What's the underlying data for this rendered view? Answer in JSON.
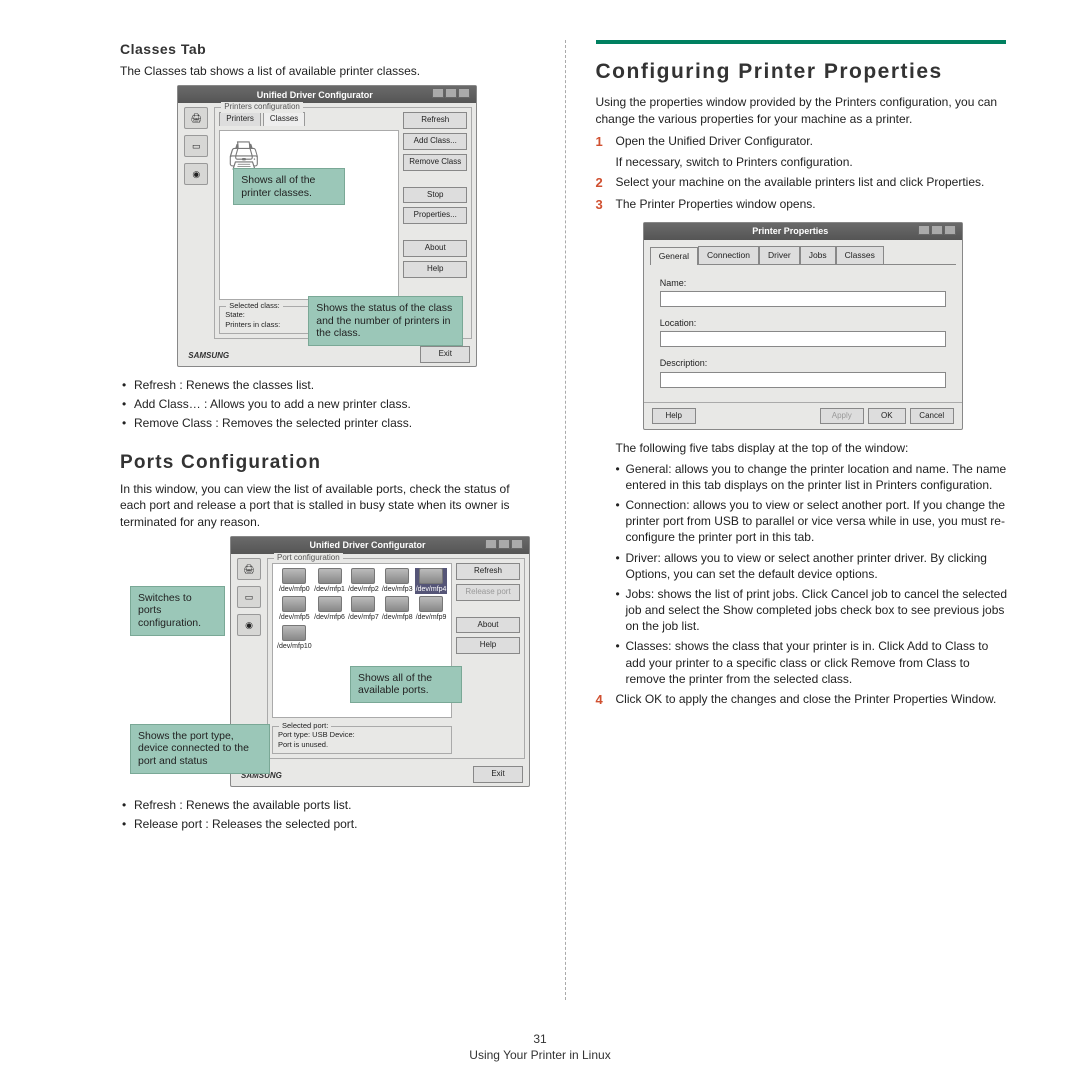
{
  "left": {
    "classes_heading": "Classes Tab",
    "classes_intro": "The Classes tab shows a list of available printer classes.",
    "classes_win_title": "Unified Driver Configurator",
    "classes_frame": "Printers configuration",
    "classes_tab_printers": "Printers",
    "classes_tab_classes": "Classes",
    "classes_buttons": {
      "refresh": "Refresh",
      "add": "Add Class...",
      "remove": "Remove Class",
      "stop": "Stop",
      "properties": "Properties...",
      "about": "About",
      "help": "Help"
    },
    "classes_sel_label": "Selected class:",
    "classes_sel_state": "State:",
    "classes_sel_printers": "Printers in class:",
    "classes_exit": "Exit",
    "classes_brand": "SAMSUNG",
    "callout_classes_1": "Shows all of the printer classes.",
    "callout_classes_2": "Shows the status of the class and the number of printers in the class.",
    "classes_bullets": [
      "Refresh : Renews the classes list.",
      "Add Class… : Allows you to add a new printer class.",
      "Remove Class : Removes the selected printer class."
    ],
    "ports_heading": "Ports Configuration",
    "ports_intro": "In this window, you can view the list of available ports, check the status of each port and release a port that is stalled in busy state when its owner is terminated for any reason.",
    "ports_win_title": "Unified Driver Configurator",
    "ports_frame": "Port configuration",
    "port_labels": [
      "/dev/mfp0",
      "/dev/mfp1",
      "/dev/mfp2",
      "/dev/mfp3",
      "/dev/mfp4",
      "/dev/mfp5",
      "/dev/mfp6",
      "/dev/mfp7",
      "/dev/mfp8",
      "/dev/mfp9",
      "/dev/mfp10"
    ],
    "ports_buttons": {
      "refresh": "Refresh",
      "release": "Release port",
      "about": "About",
      "help": "Help"
    },
    "ports_sel_label": "Selected port:",
    "ports_sel_type": "Port type: USB   Device:",
    "ports_sel_status": "Port is unused.",
    "ports_exit": "Exit",
    "callout_ports_1": "Switches to ports configuration.",
    "callout_ports_2": "Shows all of the available ports.",
    "callout_ports_3": "Shows the port type, device connected to the port and status",
    "ports_bullets": [
      "Refresh : Renews the available ports list.",
      "Release port : Releases the selected port."
    ]
  },
  "right": {
    "title": "Configuring Printer Properties",
    "intro": "Using the properties window provided by the Printers configuration, you can change the various properties for your machine as a printer.",
    "step1": "Open the Unified Driver Configurator.",
    "step1b": "If necessary, switch to Printers configuration.",
    "step2": "Select your machine on the available printers list and click Properties.",
    "step3": "The Printer Properties window opens.",
    "prop_win_title": "Printer Properties",
    "prop_tabs": [
      "General",
      "Connection",
      "Driver",
      "Jobs",
      "Classes"
    ],
    "prop_fields": {
      "name": "Name:",
      "location": "Location:",
      "description": "Description:"
    },
    "prop_buttons": {
      "help": "Help",
      "apply": "Apply",
      "ok": "OK",
      "cancel": "Cancel"
    },
    "after_win": "The following five tabs display at the top of the window:",
    "tab_descs": [
      "General: allows you to change the printer location and name. The name entered in this tab displays on the printer list in Printers configuration.",
      "Connection: allows you to view or select another port. If you change the printer port from USB to parallel or vice versa while in use, you must re-configure the printer port in this tab.",
      "Driver: allows you to view or select another printer driver. By clicking Options, you can set the default device options.",
      "Jobs: shows the list of print jobs. Click Cancel job to cancel the selected job and select the Show completed jobs check box to see previous jobs on the job list.",
      "Classes: shows the class that your printer is in. Click Add to Class to add your printer to a specific class or click Remove from Class to remove the printer from the selected class."
    ],
    "step4": "Click OK to apply the changes and close the Printer Properties Window."
  },
  "footer": {
    "page": "31",
    "section": "Using Your Printer in Linux"
  }
}
